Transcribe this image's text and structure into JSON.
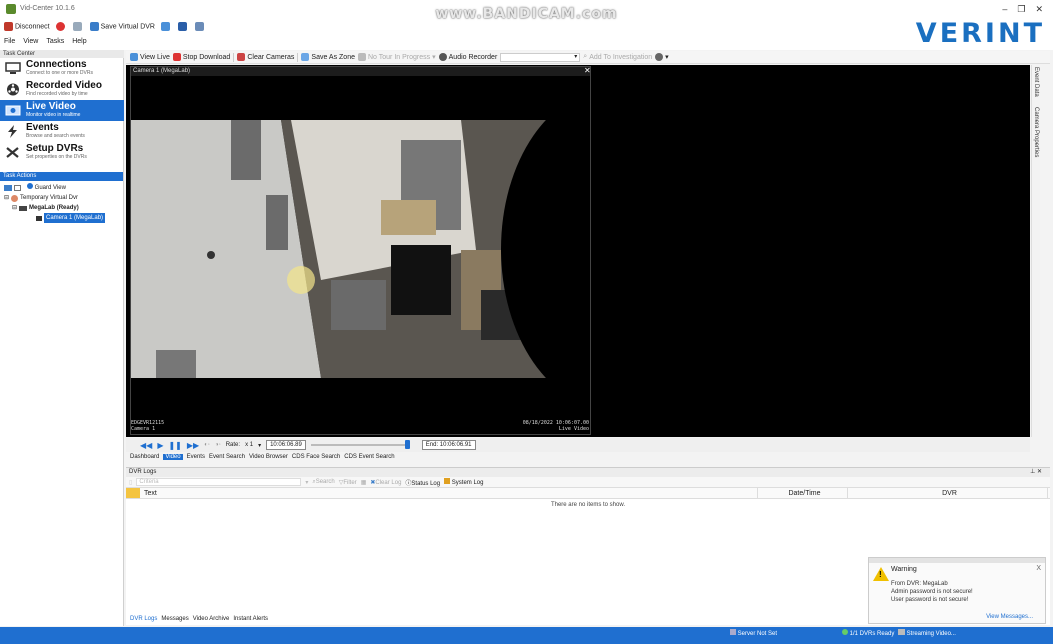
{
  "app": {
    "title": "Vid-Center 10.1.6",
    "brand": "VERINT",
    "watermark": "www.BANDICAM.com"
  },
  "quickbar": {
    "disconnect": "Disconnect",
    "save_virtual_dvr": "Save Virtual DVR"
  },
  "menu": [
    "File",
    "View",
    "Tasks",
    "Help"
  ],
  "task_center": {
    "header": "Task Center",
    "items": [
      {
        "title": "Connections",
        "subtitle": "Connect to one or more DVRs",
        "icon": "monitor-icon"
      },
      {
        "title": "Recorded Video",
        "subtitle": "Find recorded video by time",
        "icon": "film-reel-icon"
      },
      {
        "title": "Live Video",
        "subtitle": "Monitor video in realtime",
        "icon": "live-camera-icon"
      },
      {
        "title": "Events",
        "subtitle": "Browse and search events",
        "icon": "lightning-icon"
      },
      {
        "title": "Setup DVRs",
        "subtitle": "Set properties on the DVRs",
        "icon": "tools-icon"
      }
    ]
  },
  "task_actions": {
    "header": "Task Actions",
    "guard_view": "Guard View",
    "tree": {
      "root": "Temporary Virtual Dvr",
      "dvr": "MegaLab (Ready)",
      "camera": "Camera 1 (MegaLab)"
    }
  },
  "toolbar": {
    "view_live": "View Live",
    "stop_download": "Stop Download",
    "clear_cameras": "Clear Cameras",
    "save_as_zone": "Save As Zone",
    "no_tour": "No Tour In Progress",
    "audio_recorder": "Audio Recorder",
    "add_to_investigation": "Add To Investigation"
  },
  "video": {
    "pane_title": "Camera 1 (MegaLab)",
    "overlay_left_1": "EDGEVR12115",
    "overlay_left_2": "Camera 1",
    "overlay_right_1": "08/18/2022 10:06:07.00",
    "overlay_right_2": "Live Video"
  },
  "right_tabs": [
    "Event Data",
    "Camera Properties"
  ],
  "playback": {
    "rate_label": "Rate:",
    "rate_value": "x 1",
    "time": "10:06:06.89",
    "end": "End: 10:06:06.91"
  },
  "view_tabs": [
    "Dashboard",
    "Video",
    "Events",
    "Event Search",
    "Video Browser",
    "CDS Face Search",
    "CDS Event Search"
  ],
  "logs": {
    "title": "DVR Logs",
    "criteria_placeholder": "Criteria",
    "search": "Search",
    "filter": "Filter",
    "clear_log": "Clear Log",
    "status_log": "Status Log",
    "system_log": "System Log",
    "columns": [
      "Text",
      "Date/Time",
      "DVR"
    ],
    "empty": "There are no items to show."
  },
  "bottom_tabs": [
    "DVR Logs",
    "Messages",
    "Video Archive",
    "Instant Alerts"
  ],
  "warning": {
    "title": "Warning",
    "line1": "From DVR: MegaLab",
    "line2": "Admin password is not secure!",
    "line3": "User password is not secure!",
    "link": "View Messages..."
  },
  "status": {
    "server": "Server Not Set",
    "dvrs": "1/1 DVRs Ready",
    "streaming": "Streaming Video..."
  },
  "colors": {
    "accent": "#1f6fd0",
    "brand": "#1a6fc0"
  }
}
